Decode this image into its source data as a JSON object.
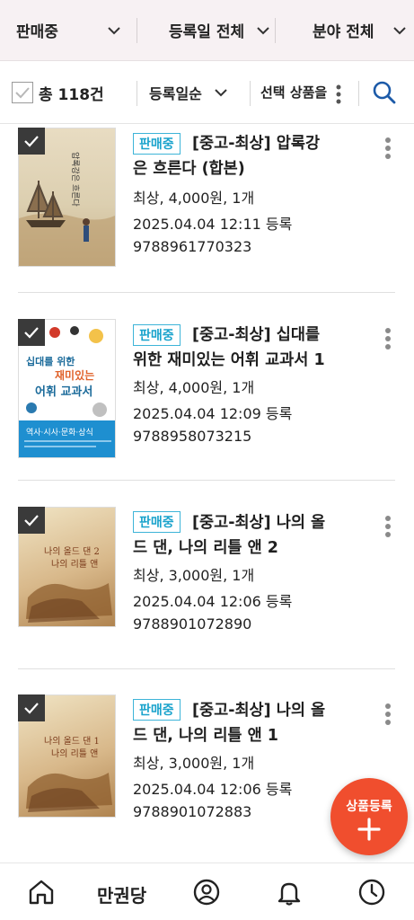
{
  "filters": {
    "status": "판매중",
    "date": "등록일 전체",
    "category": "분야 전체"
  },
  "toolbar": {
    "total": "총 118건",
    "sort": "등록일순",
    "select_items": "선택 상품을"
  },
  "products": [
    {
      "status": "판매중",
      "title": "[중고-최상] 압록강 은 흐른다 (합본)",
      "title_line1": "[중고-최상] 압록강",
      "title_line2": "은 흐른다 (합본)",
      "details": "최상, 4,000원, 1개",
      "registered": "2025.04.04 12:11 등록",
      "isbn": "9788961770323",
      "cover_text": "압록강은 흐른다"
    },
    {
      "status": "판매중",
      "title": "[중고-최상] 십대를 위한 재미있는 어휘 교과서 1",
      "title_line1": "[중고-최상] 십대를",
      "title_line2": "위한 재미있는 어휘 교과서 1",
      "details": "최상, 4,000원, 1개",
      "registered": "2025.04.04 12:09 등록",
      "isbn": "9788958073215",
      "cover_text": "십대를 위한 재미있는 어휘 교과서",
      "cover_sub": "역사·시사·문화·상식"
    },
    {
      "status": "판매중",
      "title": "[중고-최상] 나의 올 드 댄, 나의 리틀 앤 2",
      "title_line1": "[중고-최상] 나의 올",
      "title_line2": "드 댄, 나의 리틀 앤 2",
      "details": "최상, 3,000원, 1개",
      "registered": "2025.04.04 12:06 등록",
      "isbn": "9788901072890",
      "cover_text": "나의 올드 댄 2 나의 리틀 앤"
    },
    {
      "status": "판매중",
      "title": "[중고-최상] 나의 올 드 댄, 나의 리틀 앤 1",
      "title_line1": "[중고-최상] 나의 올",
      "title_line2": "드 댄, 나의 리틀 앤 1",
      "details": "최상, 3,000원, 1개",
      "registered": "2025.04.04 12:06 등록",
      "isbn": "9788901072883",
      "cover_text": "나의 올드 댄 1 나의 리틀 앤"
    }
  ],
  "fab": {
    "label": "상품등록"
  },
  "bottom_nav": {
    "brand": "만권당",
    "icons": [
      "home-icon",
      "profile-icon",
      "bell-icon",
      "clock-icon"
    ]
  },
  "colors": {
    "accent": "#1aa3cc",
    "fab": "#f04e2e",
    "filter_bg": "#f7f1f3",
    "search": "#1c5aa8"
  }
}
